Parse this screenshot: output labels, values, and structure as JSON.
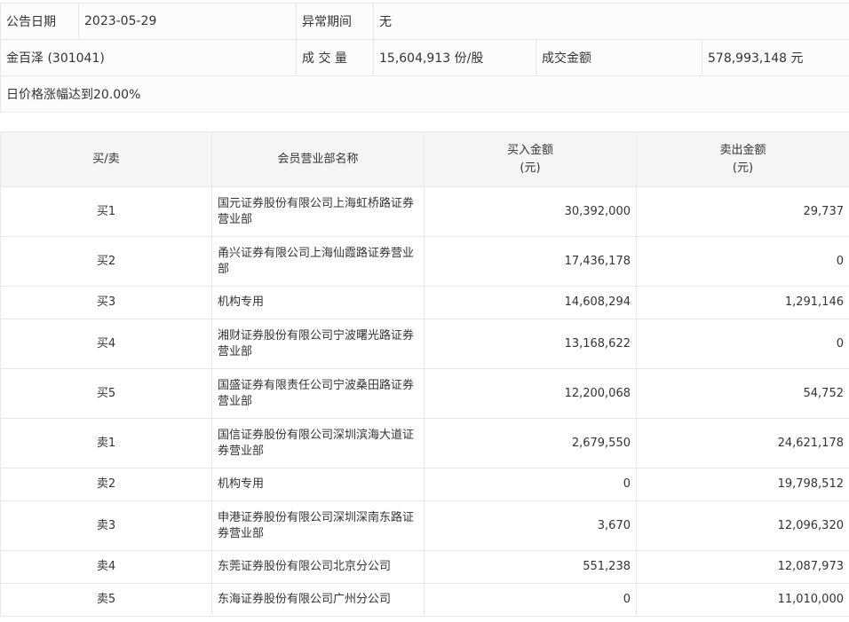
{
  "info": {
    "date_label": "公告日期",
    "date": "2023-05-29",
    "period_label": "异常期间",
    "period": "无",
    "stock": "金百泽 (301041)",
    "volume_label": "成 交 量",
    "volume": "15,604,913 份/股",
    "amount_label": "成交金额",
    "amount": "578,993,148 元",
    "reason": "日价格涨幅达到20.00%"
  },
  "table": {
    "headers": [
      "买/卖",
      "会员营业部名称",
      "买入金额",
      "(元)",
      "卖出金额",
      "(元)"
    ],
    "rows": [
      {
        "side": "买1",
        "name": "国元证券股份有限公司上海虹桥路证券营业部",
        "buy": "30,392,000",
        "sell": "29,737"
      },
      {
        "side": "买2",
        "name": "甬兴证券有限公司上海仙霞路证券营业部",
        "buy": "17,436,178",
        "sell": "0"
      },
      {
        "side": "买3",
        "name": "机构专用",
        "buy": "14,608,294",
        "sell": "1,291,146"
      },
      {
        "side": "买4",
        "name": "湘财证券股份有限公司宁波曙光路证券营业部",
        "buy": "13,168,622",
        "sell": "0"
      },
      {
        "side": "买5",
        "name": "国盛证券有限责任公司宁波桑田路证券营业部",
        "buy": "12,200,068",
        "sell": "54,752"
      },
      {
        "side": "卖1",
        "name": "国信证券股份有限公司深圳滨海大道证券营业部",
        "buy": "2,679,550",
        "sell": "24,621,178"
      },
      {
        "side": "卖2",
        "name": "机构专用",
        "buy": "0",
        "sell": "19,798,512"
      },
      {
        "side": "卖3",
        "name": "申港证券股份有限公司深圳深南东路证券营业部",
        "buy": "3,670",
        "sell": "12,096,320"
      },
      {
        "side": "卖4",
        "name": "东莞证券股份有限公司北京分公司",
        "buy": "551,238",
        "sell": "12,087,973"
      },
      {
        "side": "卖5",
        "name": "东海证券股份有限公司广州分公司",
        "buy": "0",
        "sell": "11,010,000"
      }
    ]
  }
}
